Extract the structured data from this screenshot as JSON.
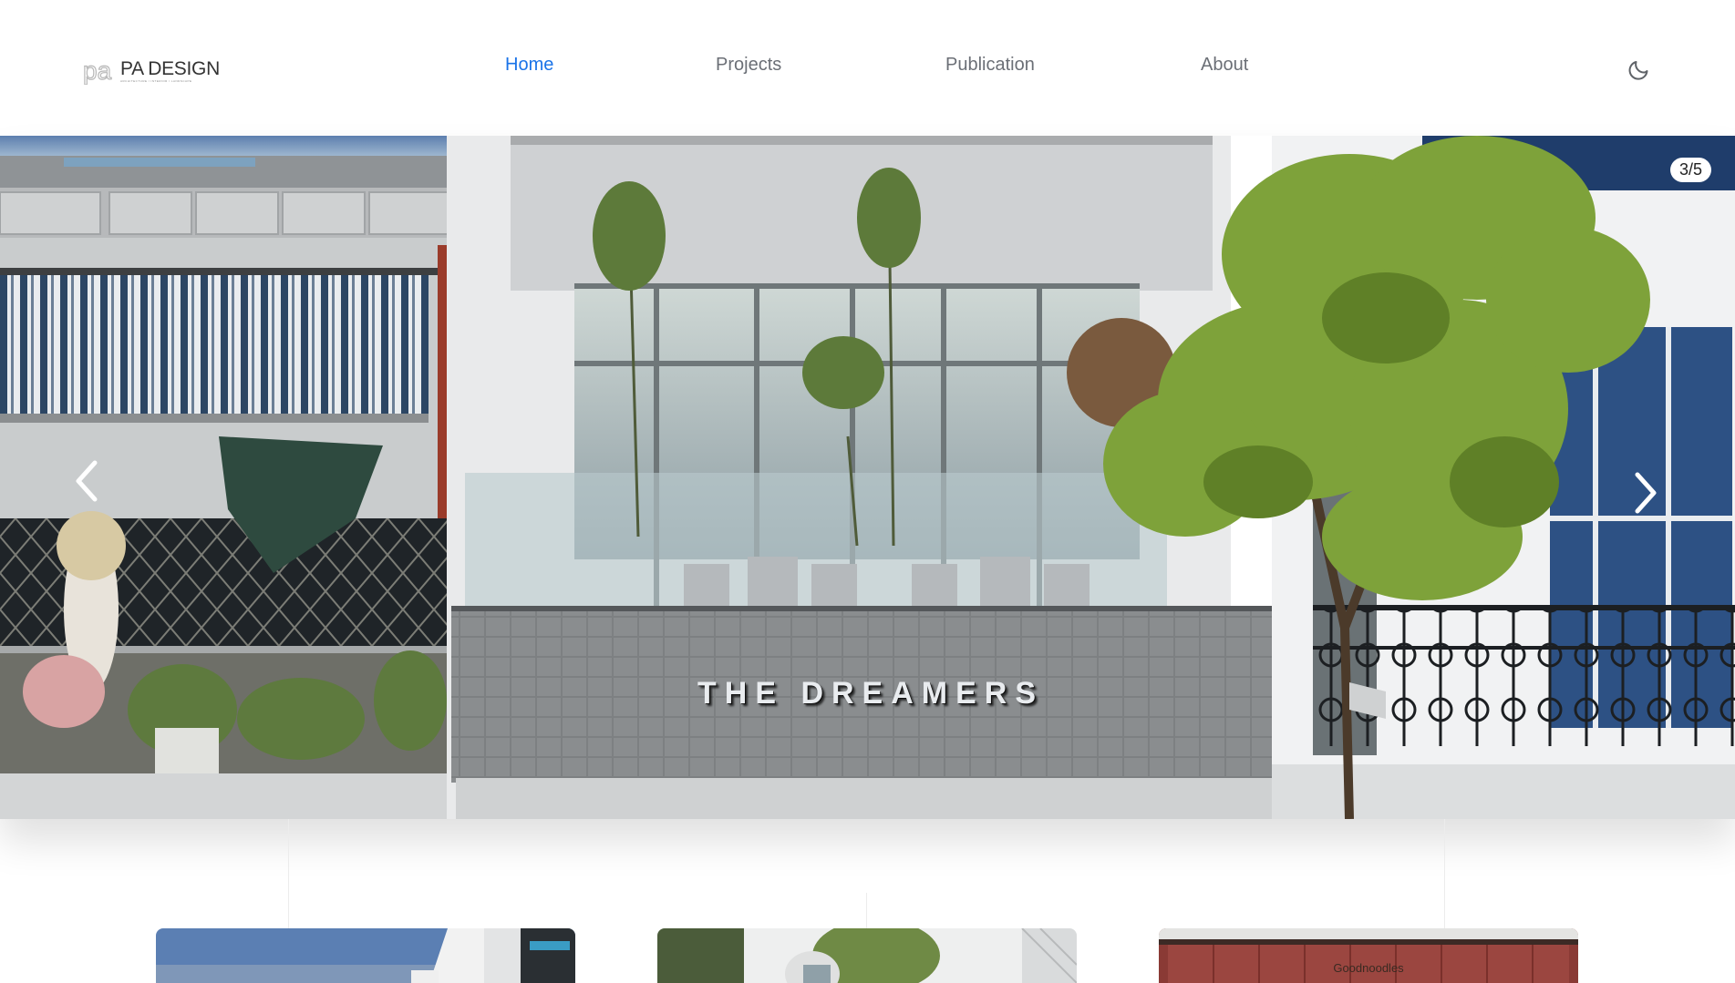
{
  "brand": {
    "logo_text": "PA DESIGN",
    "logo_tagline": "ARCHITECTURE / INTERIOR / LANDSCAPE",
    "logo_mark": "pa"
  },
  "nav": {
    "items": [
      {
        "label": "Home",
        "active": true
      },
      {
        "label": "Projects",
        "active": false
      },
      {
        "label": "Publication",
        "active": false
      },
      {
        "label": "About",
        "active": false
      }
    ],
    "active_color": "#1a73e8",
    "text_color": "#6b6f76"
  },
  "theme_toggle": {
    "icon": "moon-icon"
  },
  "hero": {
    "counter": "3/5",
    "sign_text": "THE DREAMERS",
    "prev_icon": "chevron-left-icon",
    "next_icon": "chevron-right-icon"
  },
  "cards": [
    {
      "caption": ""
    },
    {
      "caption": ""
    },
    {
      "caption": "Goodnoodles"
    }
  ]
}
